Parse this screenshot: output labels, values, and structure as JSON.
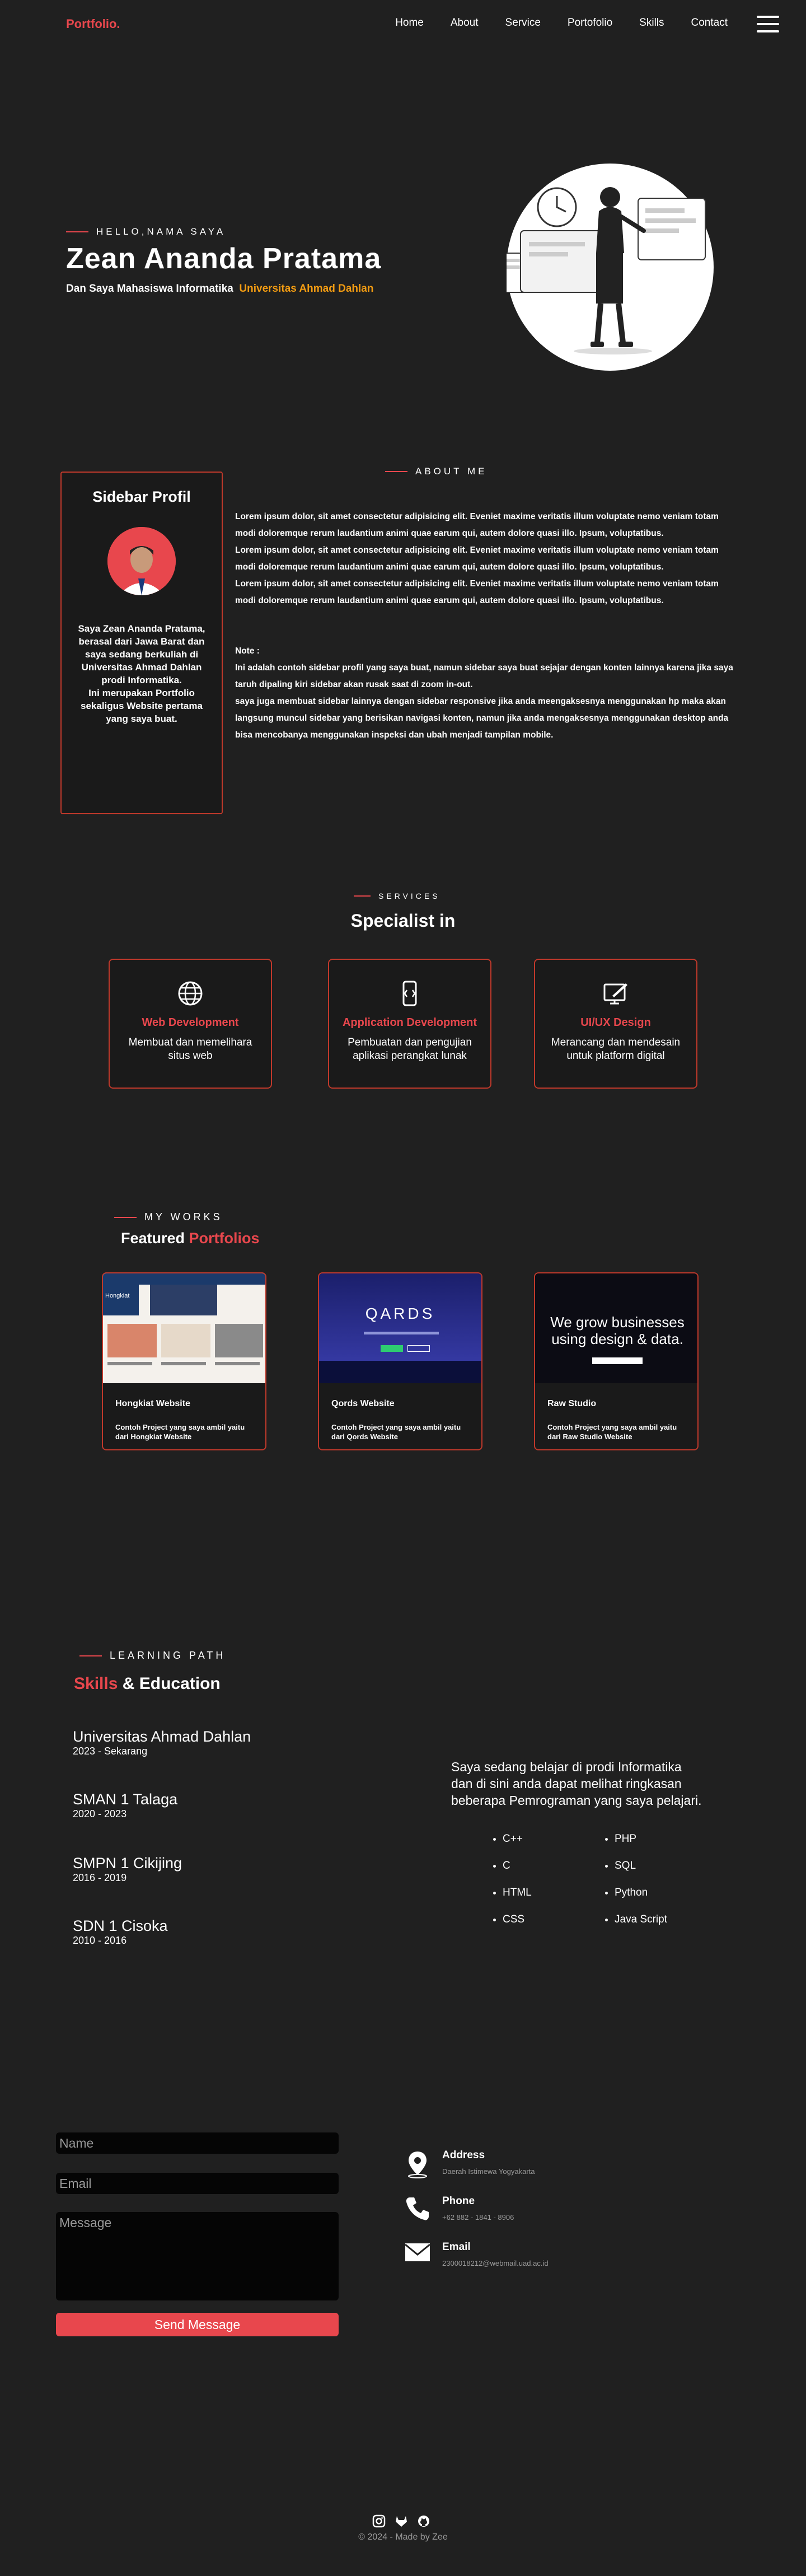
{
  "nav": {
    "logo": "Portfolio.",
    "items": [
      "Home",
      "About",
      "Service",
      "Portofolio",
      "Skills",
      "Contact"
    ]
  },
  "hero": {
    "eyebrow": "HELLO,NAMA SAYA",
    "name": "Zean Ananda Pratama",
    "subtitle": "Dan Saya Mahasiswa Informatika",
    "university": "Universitas Ahmad Dahlan"
  },
  "about": {
    "eyebrow": "ABOUT ME",
    "sidebar_title": "Sidebar Profil",
    "sidebar_text": [
      "Saya Zean Ananda Pratama,",
      "berasal dari Jawa Barat dan",
      "saya sedang berkuliah di",
      "Universitas Ahmad Dahlan",
      "prodi Informatika.",
      "Ini merupakan Portfolio",
      "sekaligus Website pertama",
      "yang saya buat."
    ],
    "paragraph_lines": [
      "Lorem ipsum dolor, sit amet consectetur adipisicing elit. Eveniet maxime veritatis illum voluptate nemo veniam totam",
      "modi doloremque rerum laudantium animi quae earum qui, autem dolore quasi illo. Ipsum, voluptatibus.",
      "Lorem ipsum dolor, sit amet consectetur adipisicing elit. Eveniet maxime veritatis illum voluptate nemo veniam totam",
      "modi doloremque rerum laudantium animi quae earum qui, autem dolore quasi illo. Ipsum, voluptatibus.",
      "Lorem ipsum dolor, sit amet consectetur adipisicing elit. Eveniet maxime veritatis illum voluptate nemo veniam totam",
      "modi doloremque rerum laudantium animi quae earum qui, autem dolore quasi illo. Ipsum, voluptatibus."
    ],
    "note_label": "Note :",
    "note_lines": [
      "Ini adalah contoh sidebar profil yang saya buat, namun sidebar saya buat sejajar dengan konten lainnya karena jika saya",
      "taruh dipaling kiri sidebar akan rusak saat di zoom in-out.",
      "saya juga membuat sidebar lainnya dengan sidebar responsive jika anda meengaksesnya menggunakan hp maka akan",
      "langsung muncul sidebar yang berisikan navigasi konten, namun jika anda mengaksesnya menggunakan desktop anda",
      "bisa mencobanya menggunakan inspeksi dan ubah menjadi tampilan mobile."
    ]
  },
  "services": {
    "eyebrow": "SERVICES",
    "title": "Specialist in",
    "cards": [
      {
        "title": "Web Development",
        "lines": [
          "Membuat dan memelihara",
          "situs web"
        ],
        "icon": "globe-icon"
      },
      {
        "title": "Application Development",
        "lines": [
          "Pembuatan dan pengujian",
          "aplikasi perangkat lunak"
        ],
        "icon": "phone-code-icon"
      },
      {
        "title": "UI/UX Design",
        "lines": [
          "Merancang dan mendesain",
          "untuk platform digital"
        ],
        "icon": "design-icon"
      }
    ]
  },
  "works": {
    "eyebrow": "MY WORKS",
    "title_a": "Featured",
    "title_b": "Portfolios",
    "cards": [
      {
        "title": "Hongkiat Website",
        "desc": [
          "Contoh Project yang saya ambil yaitu",
          "dari Hongkiat Website"
        ],
        "shot_text": "Hongkiat"
      },
      {
        "title": "Qords Website",
        "desc": [
          "Contoh Project yang saya ambil yaitu",
          "dari Qords Website"
        ],
        "shot_text": "QARDS"
      },
      {
        "title": "Raw Studio",
        "desc": [
          "Contoh Project yang saya ambil yaitu",
          "dari Raw Studio Website"
        ],
        "shot_text": "We grow businesses using design & data."
      }
    ]
  },
  "learning": {
    "eyebrow": "LEARNING PATH",
    "title_a": "Skills",
    "title_b": "& Education",
    "education": [
      {
        "school": "Universitas Ahmad Dahlan",
        "years": "2023 - Sekarang"
      },
      {
        "school": "SMAN 1 Talaga",
        "years": "2020 - 2023"
      },
      {
        "school": "SMPN 1 Cikijing",
        "years": "2016 - 2019"
      },
      {
        "school": "SDN 1 Cisoka",
        "years": "2010 - 2016"
      }
    ],
    "intro_lines": [
      "Saya sedang belajar di prodi Informatika",
      "dan di sini anda dapat melihat ringkasan",
      "beberapa Pemrograman yang saya pelajari."
    ],
    "skills_left": [
      "C++",
      "C",
      "HTML",
      "CSS"
    ],
    "skills_right": [
      "PHP",
      "SQL",
      "Python",
      "Java Script"
    ]
  },
  "contact": {
    "name_placeholder": "Name",
    "email_placeholder": "Email",
    "message_placeholder": "Message",
    "send_label": "Send Message",
    "address_title": "Address",
    "address_value": "Daerah Istimewa Yogyakarta",
    "phone_title": "Phone",
    "phone_value": "+62 882 - 1841 - 8906",
    "email_title": "Email",
    "email_value": "2300018212@webmail.uad.ac.id"
  },
  "footer": {
    "text": "© 2024 - Made by Zee",
    "icons": [
      "instagram-icon",
      "gitlab-icon",
      "github-icon"
    ]
  }
}
